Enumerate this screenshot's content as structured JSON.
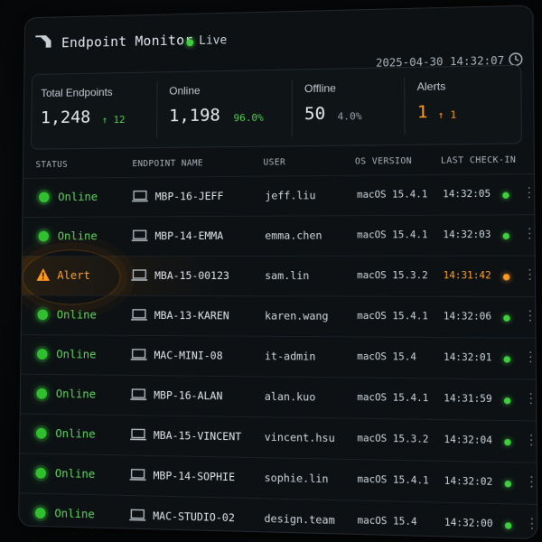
{
  "header": {
    "title": "Endpoint Monitor",
    "live_label": "Live",
    "datetime": "2025-04-30 14:32:07"
  },
  "stats": {
    "total": {
      "label": "Total Endpoints",
      "value": "1,248",
      "delta": "↑ 12"
    },
    "online": {
      "label": "Online",
      "value": "1,198",
      "pct": "96.0%"
    },
    "offline": {
      "label": "Offline",
      "value": "50",
      "pct": "4.0%"
    },
    "alerts": {
      "label": "Alerts",
      "value": "1",
      "delta": "↑ 1"
    }
  },
  "columns": {
    "status": "STATUS",
    "endpoint": "ENDPOINT NAME",
    "user": "USER",
    "os": "OS VERSION",
    "checkin": "LAST CHECK-IN"
  },
  "rows": [
    {
      "status": "Online",
      "name": "MBP-16-JEFF",
      "user": "jeff.liu",
      "os": "macOS 15.4.1",
      "checkin": "14:32:05"
    },
    {
      "status": "Online",
      "name": "MBP-14-EMMA",
      "user": "emma.chen",
      "os": "macOS 15.4.1",
      "checkin": "14:32:03"
    },
    {
      "status": "Alert",
      "name": "MBA-15-00123",
      "user": "sam.lin",
      "os": "macOS 15.3.2",
      "checkin": "14:31:42"
    },
    {
      "status": "Online",
      "name": "MBA-13-KAREN",
      "user": "karen.wang",
      "os": "macOS 15.4.1",
      "checkin": "14:32:06"
    },
    {
      "status": "Online",
      "name": "MAC-MINI-08",
      "user": "it-admin",
      "os": "macOS 15.4",
      "checkin": "14:32:01"
    },
    {
      "status": "Online",
      "name": "MBP-16-ALAN",
      "user": "alan.kuo",
      "os": "macOS 15.4.1",
      "checkin": "14:31:59"
    },
    {
      "status": "Online",
      "name": "MBA-15-VINCENT",
      "user": "vincent.hsu",
      "os": "macOS 15.3.2",
      "checkin": "14:32:04"
    },
    {
      "status": "Online",
      "name": "MBP-14-SOPHIE",
      "user": "sophie.lin",
      "os": "macOS 15.4.1",
      "checkin": "14:32:02"
    },
    {
      "status": "Online",
      "name": "MAC-STUDIO-02",
      "user": "design.team",
      "os": "macOS 15.4",
      "checkin": "14:32:00"
    }
  ],
  "colors": {
    "online": "#3ecf3e",
    "alert": "#ff9a1f",
    "background": "#0d1114"
  },
  "icons": {
    "logo": "app-logo",
    "clock": "clock-icon",
    "device": "laptop-icon",
    "warning": "warning-icon",
    "menu": "kebab-icon"
  }
}
